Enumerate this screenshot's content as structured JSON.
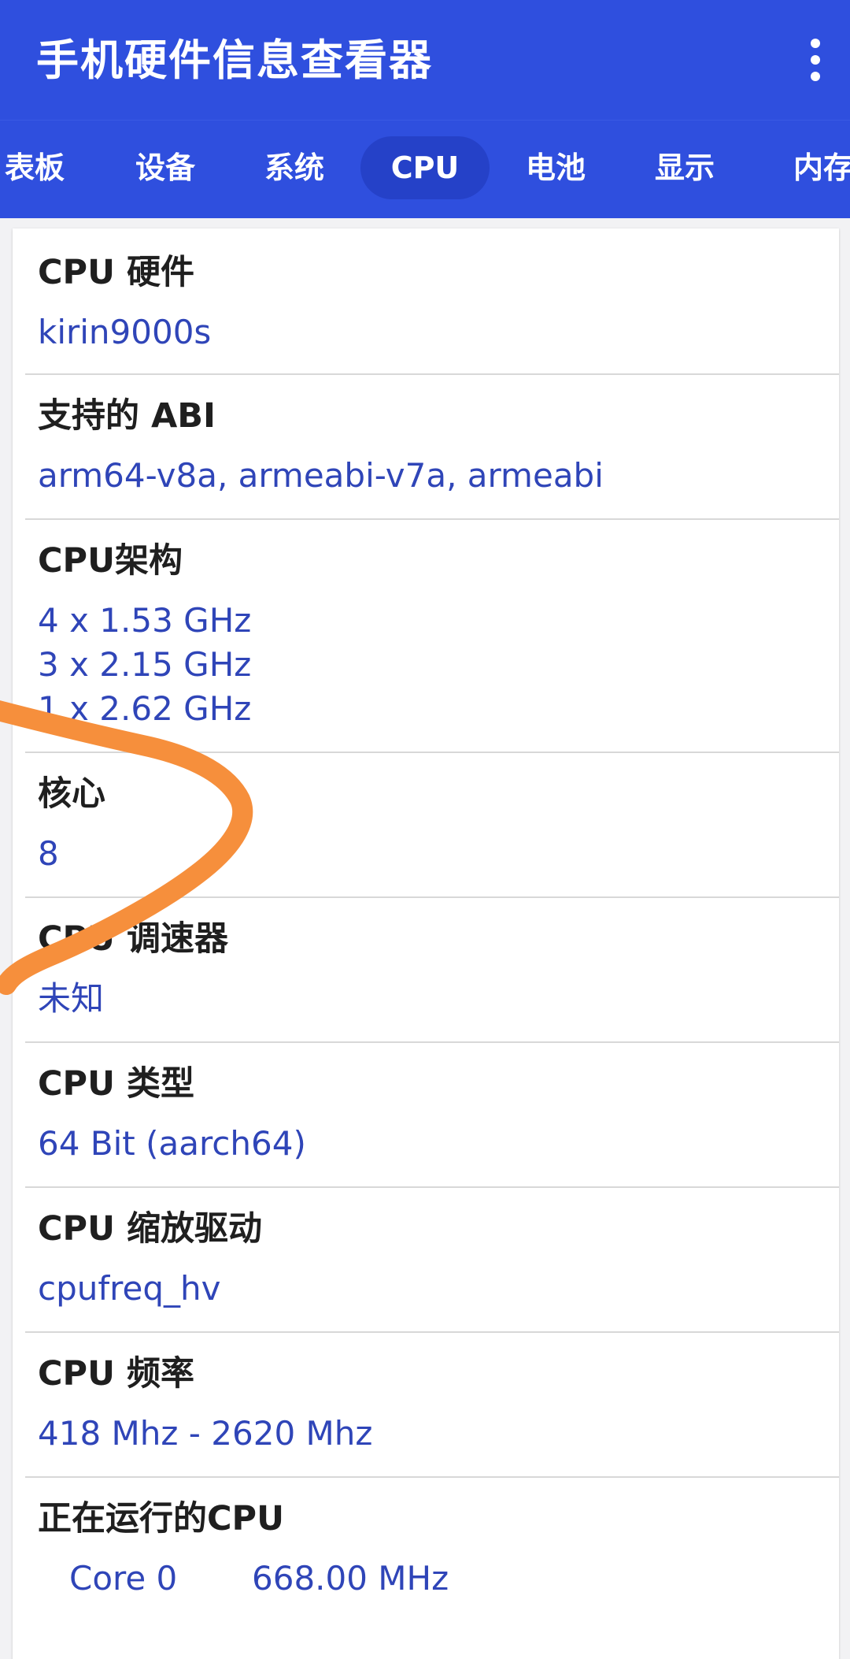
{
  "app": {
    "title": "手机硬件信息查看器",
    "accent_color": "#2f4fde",
    "value_color": "#2f45b8",
    "overflow_icon": "more-vert-icon"
  },
  "tabs": [
    {
      "label": "表板",
      "active": false
    },
    {
      "label": "设备",
      "active": false
    },
    {
      "label": "系统",
      "active": false
    },
    {
      "label": "CPU",
      "active": true
    },
    {
      "label": "电池",
      "active": false
    },
    {
      "label": "显示",
      "active": false
    },
    {
      "label": "内存",
      "active": false
    }
  ],
  "cpu_info": {
    "hardware": {
      "label": "CPU 硬件",
      "value": "kirin9000s"
    },
    "abi": {
      "label": "支持的 ABI",
      "value": "arm64-v8a, armeabi-v7a, armeabi"
    },
    "architecture": {
      "label": "CPU架构",
      "lines": [
        "4 x 1.53 GHz",
        "3 x 2.15 GHz",
        "1 x 2.62 GHz"
      ]
    },
    "cores": {
      "label": "核心",
      "value": "8"
    },
    "governor": {
      "label": "CPU 调速器",
      "value": "未知"
    },
    "type": {
      "label": "CPU 类型",
      "value": "64 Bit (aarch64)"
    },
    "scaling_driver": {
      "label": "CPU 缩放驱动",
      "value": "cpufreq_hv"
    },
    "frequency": {
      "label": "CPU 频率",
      "value": "418 Mhz - 2620 Mhz"
    },
    "running": {
      "label": "正在运行的CPU",
      "cores": [
        {
          "name": "Core 0",
          "freq": "668.00 MHz"
        }
      ]
    }
  },
  "annotation": {
    "stroke_color": "#f68f3c"
  }
}
